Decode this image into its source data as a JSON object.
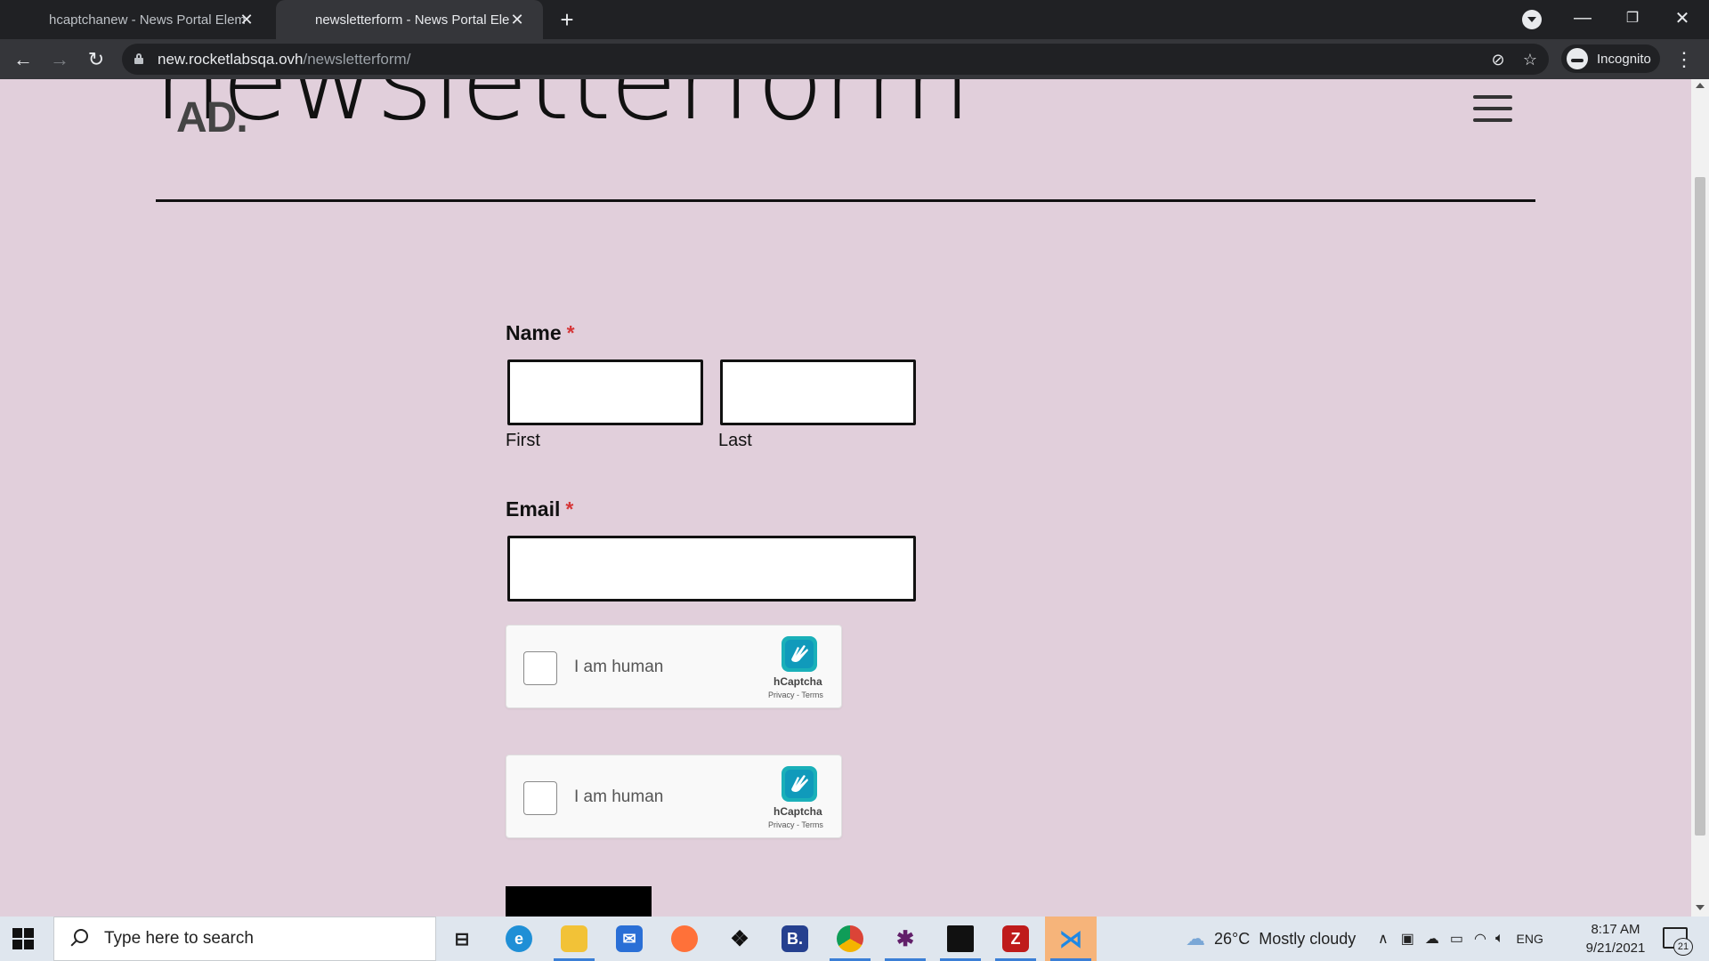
{
  "browser": {
    "tabs": [
      {
        "title": "hcaptchanew - News Portal Elem",
        "active": false
      },
      {
        "title": "newsletterform - News Portal Ele",
        "active": true
      }
    ],
    "new_tab_icon": "plus-icon",
    "omnibox": {
      "domain": "new.rocketlabsqa.ovh",
      "path": "/newsletterform/"
    },
    "profile_label": "Incognito",
    "theme_colors": {
      "tabstrip": "#202124",
      "toolbar": "#35363a"
    }
  },
  "page": {
    "background": "#e1cfdb",
    "header": {
      "title": "newsletterform",
      "logo": "AD."
    },
    "form": {
      "name_label": "Name",
      "required_mark": "*",
      "first_label": "First",
      "last_label": "Last",
      "email_label": "Email",
      "first_value": "",
      "last_value": "",
      "email_value": ""
    },
    "captchas": [
      {
        "text": "I am human",
        "brand": "hCaptcha",
        "links": "Privacy - Terms"
      },
      {
        "text": "I am human",
        "brand": "hCaptcha",
        "links": "Privacy - Terms"
      }
    ],
    "submit_label": ""
  },
  "taskbar": {
    "search_placeholder": "Type here to search",
    "apps": [
      "task-view",
      "edge",
      "file-explorer",
      "mail",
      "firefox",
      "dropbox",
      "b-app",
      "chrome",
      "slack",
      "terminal",
      "filezilla",
      "vscode"
    ],
    "weather": {
      "temp": "26°C",
      "condition": "Mostly cloudy"
    },
    "language": "ENG",
    "time": "8:17 AM",
    "date": "9/21/2021",
    "notification_count": "21"
  }
}
